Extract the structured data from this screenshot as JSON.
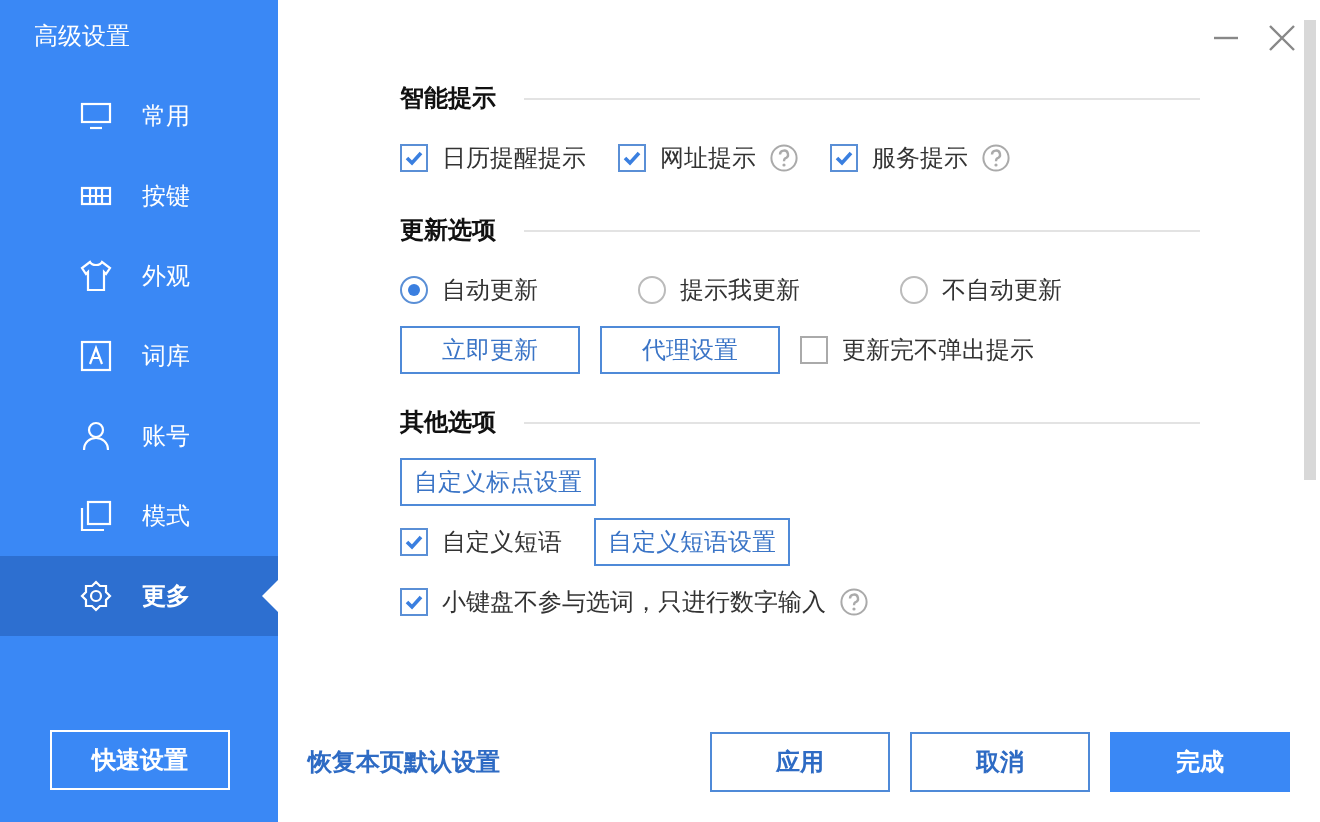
{
  "sidebar": {
    "title": "高级设置",
    "items": [
      {
        "label": "常用",
        "selected": false
      },
      {
        "label": "按键",
        "selected": false
      },
      {
        "label": "外观",
        "selected": false
      },
      {
        "label": "词库",
        "selected": false
      },
      {
        "label": "账号",
        "selected": false
      },
      {
        "label": "模式",
        "selected": false
      },
      {
        "label": "更多",
        "selected": true
      }
    ],
    "quick_button": "快速设置"
  },
  "sections": [
    {
      "title": "智能提示",
      "rows": [
        [
          {
            "kind": "checkbox",
            "label": "日历提醒提示",
            "checked": true,
            "help": false
          },
          {
            "kind": "checkbox",
            "label": "网址提示",
            "checked": true,
            "help": true
          },
          {
            "kind": "checkbox",
            "label": "服务提示",
            "checked": true,
            "help": true
          }
        ]
      ]
    },
    {
      "title": "更新选项",
      "rows": [
        [
          {
            "kind": "radio",
            "label": "自动更新",
            "selected": true
          },
          {
            "kind": "radio",
            "label": "提示我更新",
            "selected": false
          },
          {
            "kind": "radio",
            "label": "不自动更新",
            "selected": false
          }
        ],
        [
          {
            "kind": "button",
            "label": "立即更新"
          },
          {
            "kind": "button",
            "label": "代理设置"
          },
          {
            "kind": "checkbox",
            "label": "更新完不弹出提示",
            "checked": false,
            "help": false
          }
        ]
      ]
    },
    {
      "title": "其他选项",
      "rows": [
        [
          {
            "kind": "button",
            "label": "自定义标点设置"
          }
        ],
        [
          {
            "kind": "checkbox",
            "label": "自定义短语",
            "checked": true,
            "help": false
          },
          {
            "kind": "button",
            "label": "自定义短语设置"
          }
        ],
        [
          {
            "kind": "checkbox",
            "label": "小键盘不参与选词，只进行数字输入",
            "checked": true,
            "help": true
          }
        ]
      ]
    }
  ],
  "footer": {
    "reset_link": "恢复本页默认设置",
    "buttons": [
      {
        "label": "应用",
        "primary": false
      },
      {
        "label": "取消",
        "primary": false
      },
      {
        "label": "完成",
        "primary": true
      }
    ]
  }
}
